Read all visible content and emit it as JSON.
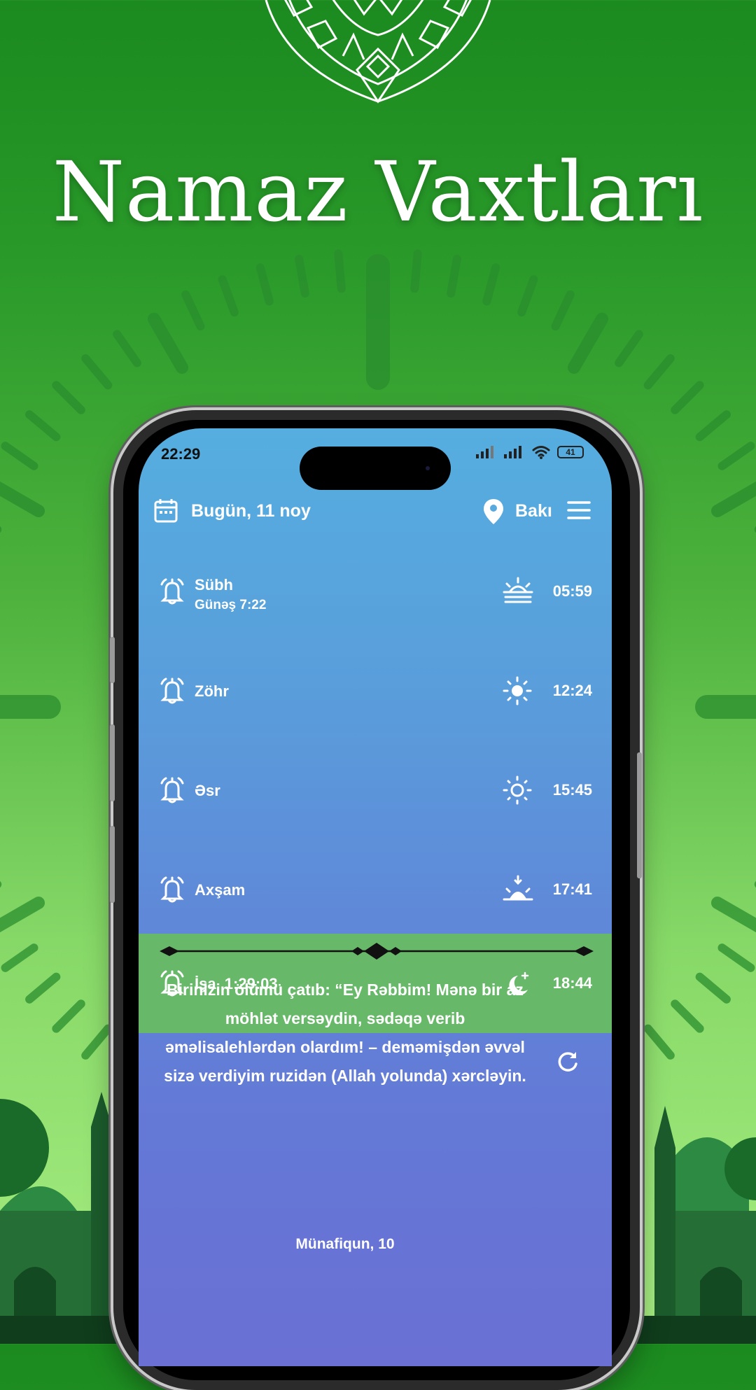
{
  "headline": "Namaz Vaxtları",
  "status_bar": {
    "time": "22:29",
    "battery": "41"
  },
  "header": {
    "date": "Bugün, 11 noy",
    "city": "Bakı"
  },
  "prayers": [
    {
      "name": "Sübh",
      "sub": "Günəş 7:22",
      "time": "05:59",
      "icon": "sunrise-icon"
    },
    {
      "name": "Zöhr",
      "time": "12:24",
      "icon": "sun-icon"
    },
    {
      "name": "Əsr",
      "time": "15:45",
      "icon": "sun-outline-icon"
    },
    {
      "name": "Axşam",
      "time": "17:41",
      "icon": "sunset-icon"
    },
    {
      "name": "İşa  1:29:03",
      "time": "18:44",
      "icon": "moon-stars-icon",
      "active": true
    }
  ],
  "quote": {
    "text": "Birinizin ölümü çatıb: “Ey Rəbbim! Mənə bir az möhlət versəydin, sədəqə verib əməlisalehlərdən olardım! – deməmişdən əvvəl sizə verdiyim ruzidən (Allah yolunda) xərcləyin.",
    "source": "Münafiqun, 10"
  },
  "colors": {
    "accent_green": "#67b869",
    "bg_green_top": "#1b8a1f",
    "bg_green_bottom": "#a8ee82"
  }
}
